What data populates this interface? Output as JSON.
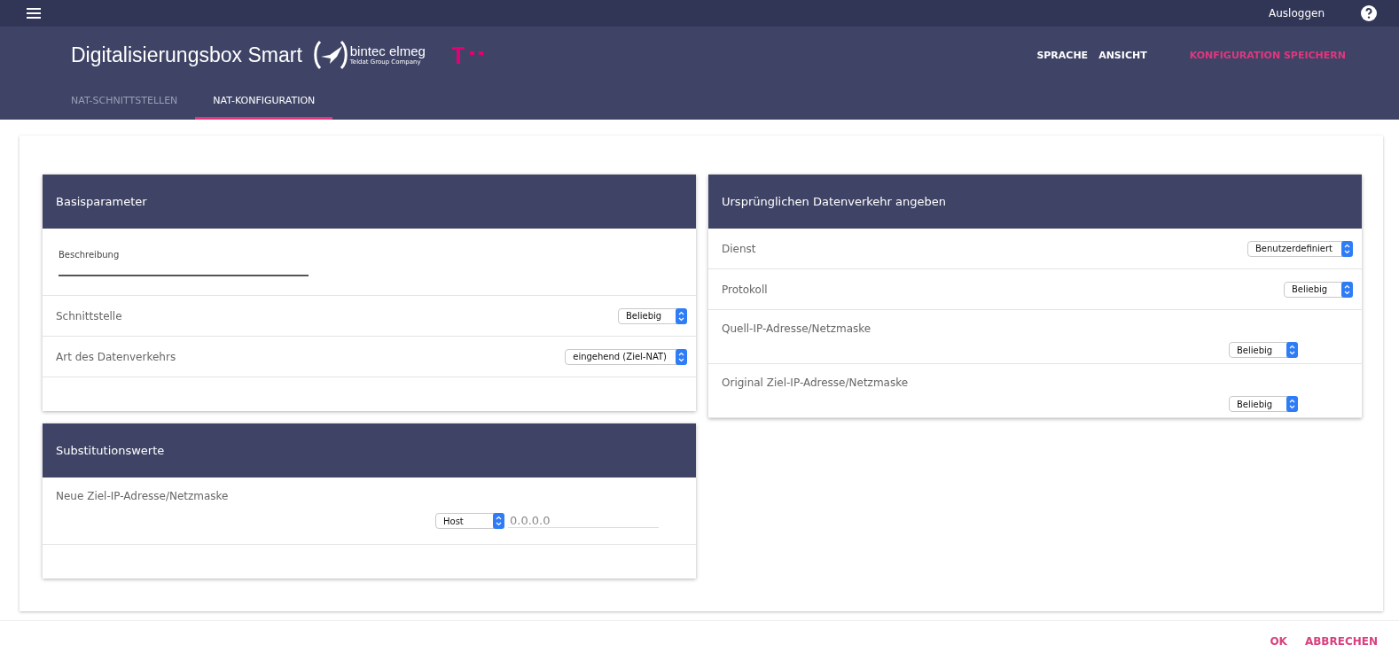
{
  "topbar": {
    "logout": "Ausloggen"
  },
  "header": {
    "title": "Digitalisierungsbox Smart",
    "brand": {
      "name": "bintec elmeg",
      "tagline": "Teldat Group Company"
    },
    "actions": [
      {
        "label": "SPRACHE",
        "kind": "plain"
      },
      {
        "label": "ANSICHT",
        "kind": "plain"
      },
      {
        "label": "KONFIGURATION SPEICHERN",
        "kind": "accent"
      }
    ]
  },
  "tabs": [
    {
      "label": "NAT-SCHNITTSTELLEN",
      "selected": false
    },
    {
      "label": "NAT-KONFIGURATION",
      "selected": true
    }
  ],
  "columns": [
    [
      {
        "title": "Basisparameter",
        "spacer": true,
        "rows": [
          {
            "kind": "text-field",
            "label": "Beschreibung"
          },
          {
            "kind": "select",
            "label": "Schnittstelle",
            "value": "Beliebig"
          },
          {
            "kind": "select",
            "label": "Art des Datenverkehrs",
            "value": "eingehend (Ziel-NAT)"
          }
        ]
      },
      {
        "title": "Substitutionswerte",
        "spacer": true,
        "rows": [
          {
            "kind": "select-with-input",
            "label": "Neue Ziel-IP-Adresse/Netzmaske",
            "value": "Host",
            "input": "0.0.0.0"
          }
        ]
      }
    ],
    [
      {
        "title": "Ursprünglichen Datenverkehr angeben",
        "spacer": false,
        "rows": [
          {
            "kind": "select",
            "label": "Dienst",
            "value": "Benutzerdefiniert"
          },
          {
            "kind": "select",
            "label": "Protokoll",
            "value": "Beliebig"
          },
          {
            "kind": "select-below",
            "label": "Quell-IP-Adresse/Netzmaske",
            "value": "Beliebig"
          },
          {
            "kind": "select-below",
            "label": "Original Ziel-IP-Adresse/Netzmaske",
            "value": "Beliebig"
          }
        ]
      }
    ]
  ],
  "footer": [
    {
      "label": "OK"
    },
    {
      "label": "ABBRECHEN"
    }
  ]
}
